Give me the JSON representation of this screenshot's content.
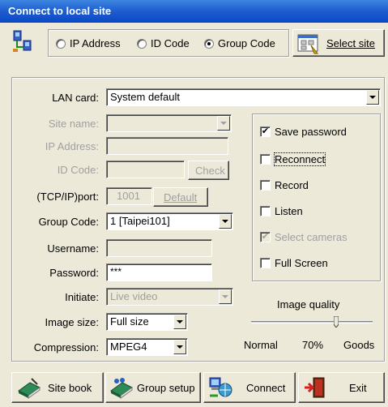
{
  "window": {
    "title": "Connect to local site"
  },
  "mode": {
    "options": [
      "IP Address",
      "ID Code",
      "Group Code"
    ],
    "selected": "Group Code"
  },
  "toolbar": {
    "select_site": "Select site"
  },
  "fields": {
    "lan_card": {
      "label": "LAN card:",
      "value": "System default"
    },
    "site_name": {
      "label": "Site name:",
      "value": ""
    },
    "ip_address": {
      "label": "IP Address:",
      "value": ""
    },
    "id_code": {
      "label": "ID Code:",
      "value": "",
      "button": "Check"
    },
    "port": {
      "label": "(TCP/IP)port:",
      "value": "1001",
      "button": "Default"
    },
    "group_code": {
      "label": "Group Code:",
      "value": "1 [Taipei101]"
    },
    "username": {
      "label": "Username:",
      "value": ""
    },
    "password": {
      "label": "Password:",
      "value": "***"
    },
    "initiate": {
      "label": "Initiate:",
      "value": "Live video"
    },
    "image_size": {
      "label": "Image size:",
      "value": "Full size"
    },
    "compression": {
      "label": "Compression:",
      "value": "MPEG4"
    }
  },
  "options": {
    "save_password": {
      "label": "Save password",
      "checked": true
    },
    "reconnect": {
      "label": "Reconnect",
      "checked": false
    },
    "record": {
      "label": "Record",
      "checked": false
    },
    "listen": {
      "label": "Listen",
      "checked": false
    },
    "select_cameras": {
      "label": "Select cameras",
      "checked": true,
      "disabled": true
    },
    "full_screen": {
      "label": "Full Screen",
      "checked": false
    }
  },
  "quality": {
    "title": "Image quality",
    "min_label": "Normal",
    "value_label": "70%",
    "max_label": "Goods",
    "level": 0.7
  },
  "buttons": {
    "site_book": "Site book",
    "group_setup": "Group setup",
    "connect": "Connect",
    "exit": "Exit"
  }
}
